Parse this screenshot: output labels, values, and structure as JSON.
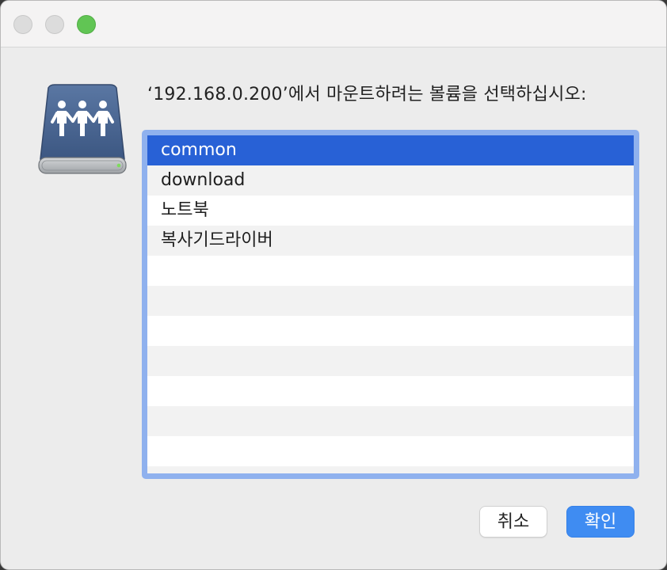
{
  "window": {
    "controls": [
      "close",
      "minimize",
      "zoom"
    ],
    "zoom_color": "#61c554"
  },
  "icon": {
    "name": "shared-server-icon",
    "color": "#4a6690"
  },
  "dialog": {
    "prompt": "‘192.168.0.200’에서 마운트하려는 볼륨을 선택하십시오:",
    "volumes": [
      {
        "label": "common",
        "selected": true
      },
      {
        "label": "download",
        "selected": false
      },
      {
        "label": "노트북",
        "selected": false
      },
      {
        "label": "복사기드라이버",
        "selected": false
      }
    ],
    "empty_rows": 7,
    "selection_color": "#2861d6"
  },
  "buttons": {
    "cancel_label": "취소",
    "ok_label": "확인",
    "accent": "#3f8cf2"
  }
}
